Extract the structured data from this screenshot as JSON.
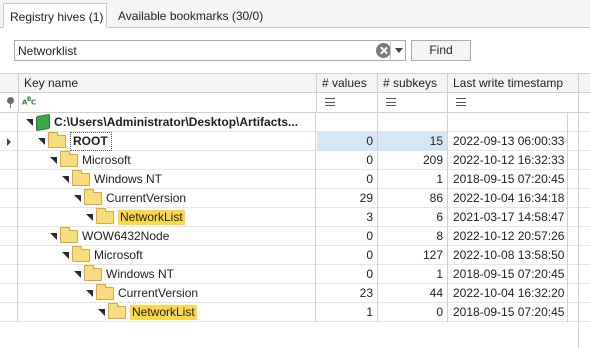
{
  "tabs": [
    {
      "label": "Registry hives (1)",
      "active": true
    },
    {
      "label": "Available bookmarks (30/0)",
      "active": false
    }
  ],
  "search": {
    "value": "Networklist",
    "find_label": "Find"
  },
  "columns": {
    "key": "Key name",
    "values": "# values",
    "subkeys": "# subkeys",
    "timestamp": "Last write timestamp"
  },
  "filter_icons": {
    "pin": "pin-icon",
    "text": "text-filter-icon",
    "equals": "equals-icon"
  },
  "colors": {
    "selected_row": "#d5e6f7",
    "highlight": "#ffd84a",
    "folder": "#f8dc84",
    "hive": "#3aa64a"
  },
  "rows": [
    {
      "name": "C:\\Users\\Administrator\\Desktop\\Artifacts...",
      "values": "",
      "subkeys": "",
      "timestamp": "",
      "level": 0,
      "icon": "hive-icon",
      "bold": true
    },
    {
      "name": "ROOT",
      "values": "0",
      "subkeys": "15",
      "timestamp": "2022-09-13 06:00:33",
      "level": 1,
      "icon": "folder-icon",
      "bold": true,
      "selected": true
    },
    {
      "name": "Microsoft",
      "values": "0",
      "subkeys": "209",
      "timestamp": "2022-10-12 16:32:33",
      "level": 2,
      "icon": "folder-icon"
    },
    {
      "name": "Windows NT",
      "values": "0",
      "subkeys": "1",
      "timestamp": "2018-09-15 07:20:45",
      "level": 3,
      "icon": "folder-icon"
    },
    {
      "name": "CurrentVersion",
      "values": "29",
      "subkeys": "86",
      "timestamp": "2022-10-04 16:34:18",
      "level": 4,
      "icon": "folder-icon"
    },
    {
      "name": "NetworkList",
      "values": "3",
      "subkeys": "6",
      "timestamp": "2021-03-17 14:58:47",
      "level": 5,
      "icon": "folder-icon",
      "highlight": true
    },
    {
      "name": "WOW6432Node",
      "values": "0",
      "subkeys": "8",
      "timestamp": "2022-10-12 20:57:26",
      "level": 2,
      "icon": "folder-icon"
    },
    {
      "name": "Microsoft",
      "values": "0",
      "subkeys": "127",
      "timestamp": "2022-10-08 13:58:50",
      "level": 3,
      "icon": "folder-icon"
    },
    {
      "name": "Windows NT",
      "values": "0",
      "subkeys": "1",
      "timestamp": "2018-09-15 07:20:45",
      "level": 4,
      "icon": "folder-icon"
    },
    {
      "name": "CurrentVersion",
      "values": "23",
      "subkeys": "44",
      "timestamp": "2022-10-04 16:32:20",
      "level": 5,
      "icon": "folder-icon"
    },
    {
      "name": "NetworkList",
      "values": "1",
      "subkeys": "0",
      "timestamp": "2018-09-15 07:20:45",
      "level": 6,
      "icon": "folder-icon",
      "highlight": true
    }
  ]
}
